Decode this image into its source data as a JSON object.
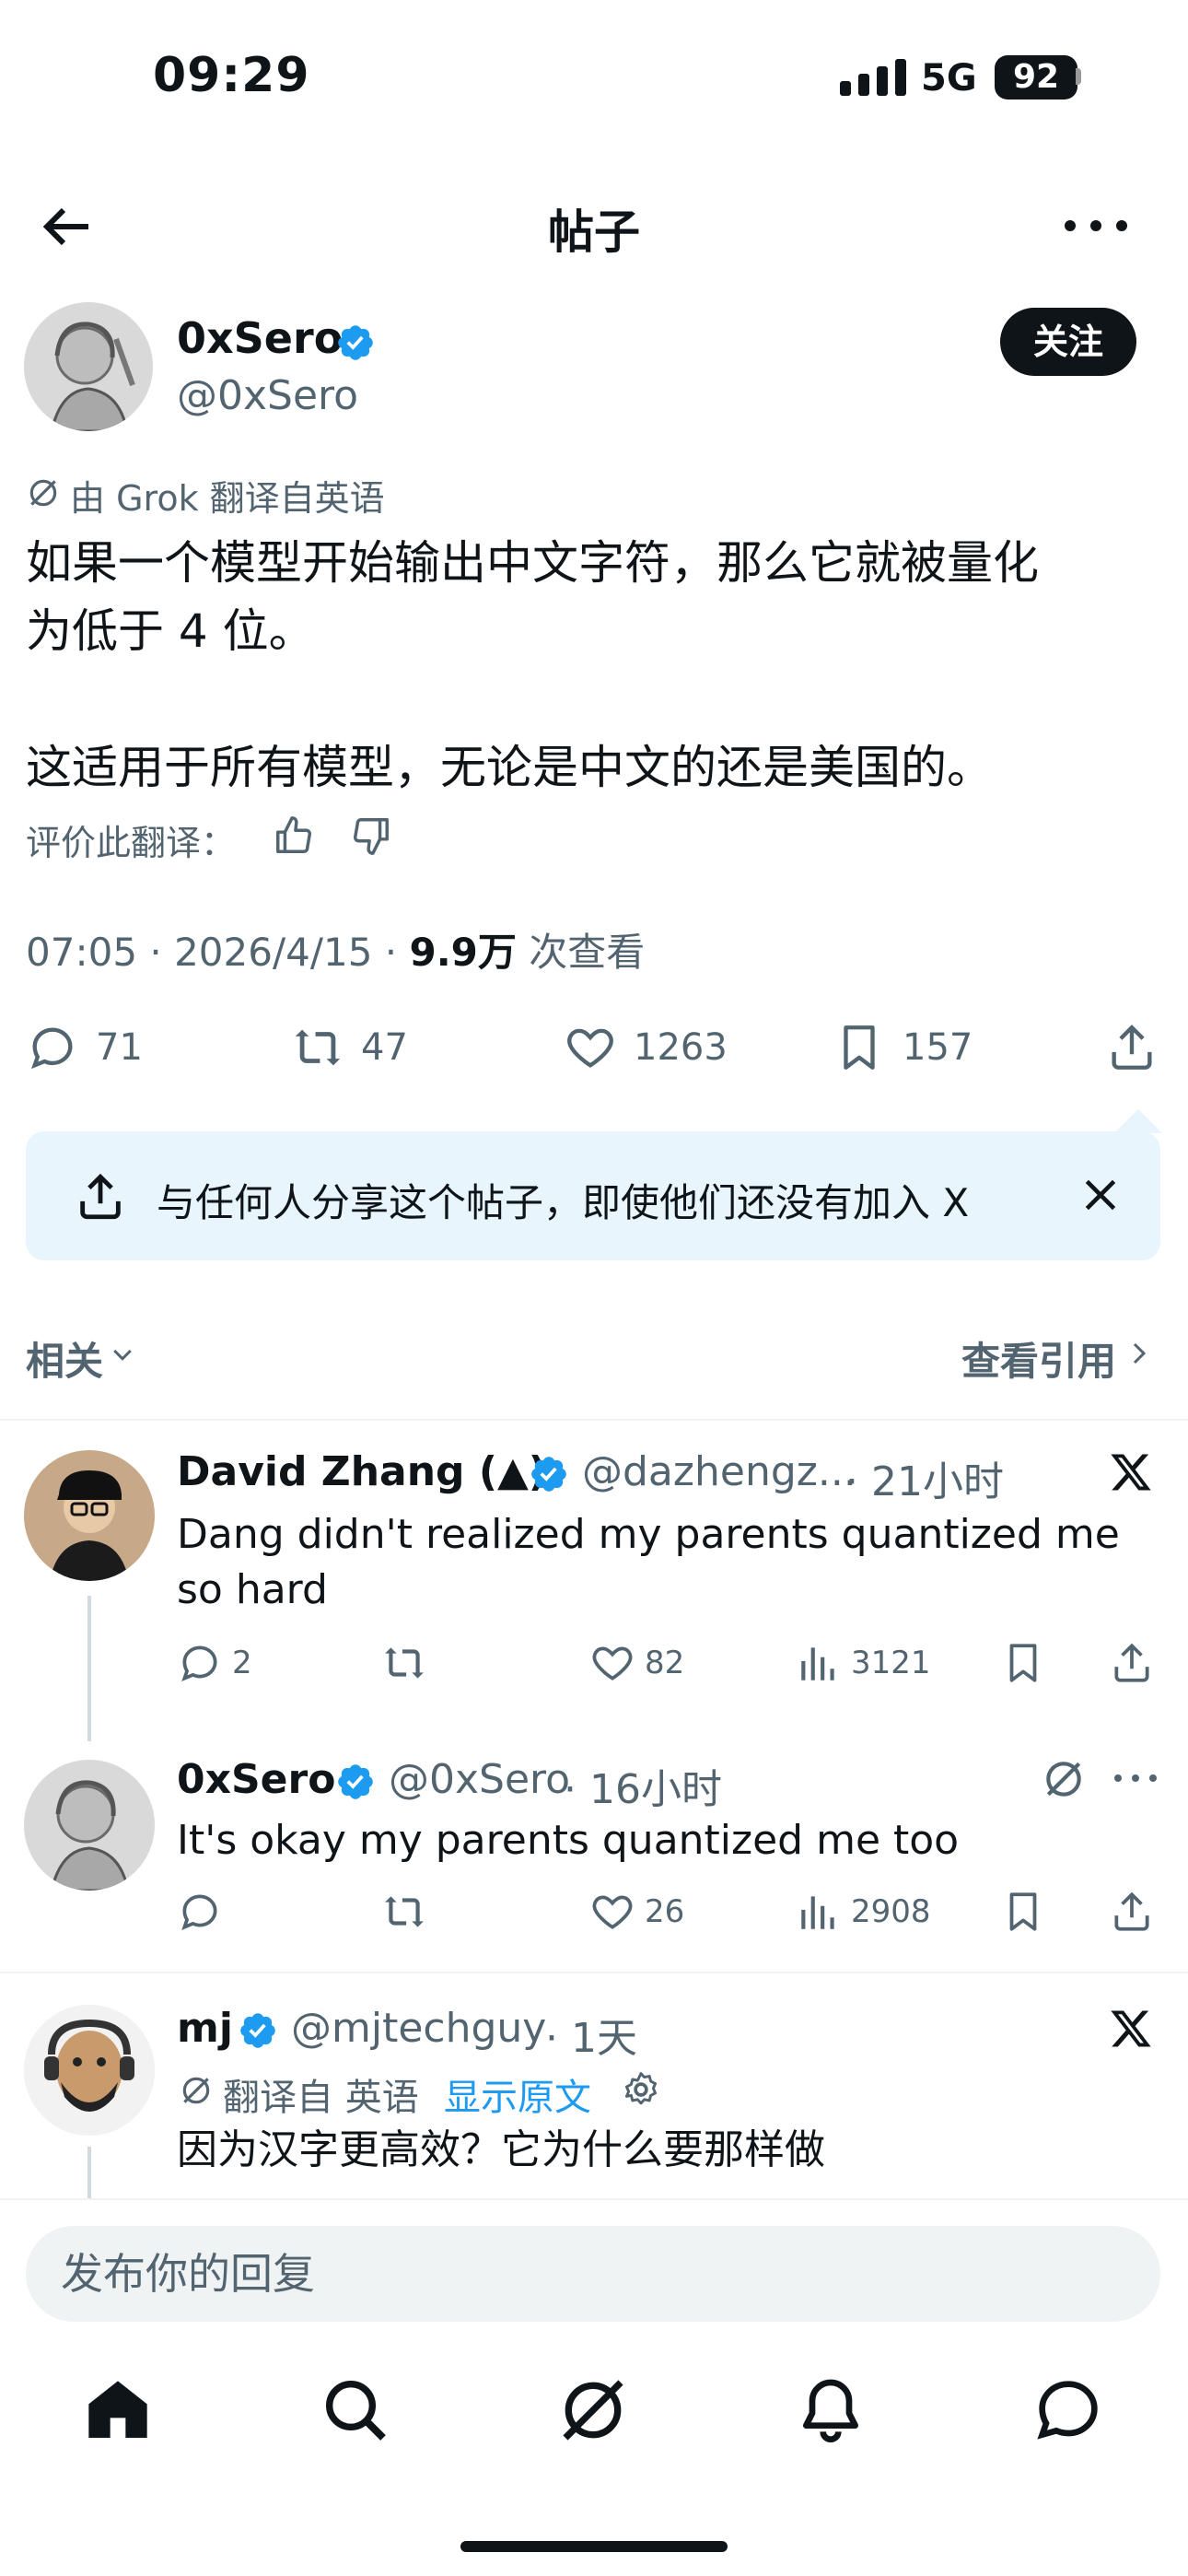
{
  "status_bar": {
    "time": "09:29",
    "network": "5G",
    "battery": "92"
  },
  "header": {
    "title": "帖子"
  },
  "post": {
    "author": {
      "name": "0xSero",
      "handle": "@0xSero"
    },
    "follow_label": "关注",
    "translation_note": "由 Grok 翻译自英语",
    "text": "如果一个模型开始输出中文字符，那么它就被量化\n为低于 4 位。\n\n这适用于所有模型，无论是中文的还是美国的。",
    "rate_label": "评价此翻译：",
    "time": "07:05 · 2026/4/15 · ",
    "views": "9.9万",
    "views_suffix": " 次查看",
    "stats": {
      "replies": "71",
      "reposts": "47",
      "likes": "1263",
      "bookmarks": "157"
    }
  },
  "share_banner": {
    "text": "与任何人分享这个帖子，即使他们还没有加入 X"
  },
  "related": {
    "label": "相关",
    "quotes_link": "查看引用"
  },
  "replies": [
    {
      "name": "David Zhang (▲)",
      "handle": "@dazhengz...",
      "time": "· 21小时",
      "text": "Dang didn't realized my parents quantized me so hard",
      "replies": "2",
      "reposts": "",
      "likes": "82",
      "views": "3121"
    },
    {
      "name": "0xSero",
      "handle": "@0xSero",
      "time": "· 16小时",
      "text": "It's okay my parents quantized me too",
      "replies": "",
      "reposts": "",
      "likes": "26",
      "views": "2908"
    },
    {
      "name": "mj",
      "handle": "@mjtechguy",
      "time": "· 1天",
      "translation_note": "翻译自 英语",
      "show_original": "显示原文",
      "text": "因为汉字更高效？它为什么要那样做"
    }
  ],
  "compose": {
    "placeholder": "发布你的回复"
  },
  "tab_bar": {
    "items": [
      "home-icon",
      "search-icon",
      "grok-icon",
      "notifications-icon",
      "messages-icon"
    ]
  },
  "colors": {
    "accent": "#1d9bf0",
    "text": "#0f1419",
    "muted": "#536471",
    "banner_bg": "#e8f5fd"
  }
}
